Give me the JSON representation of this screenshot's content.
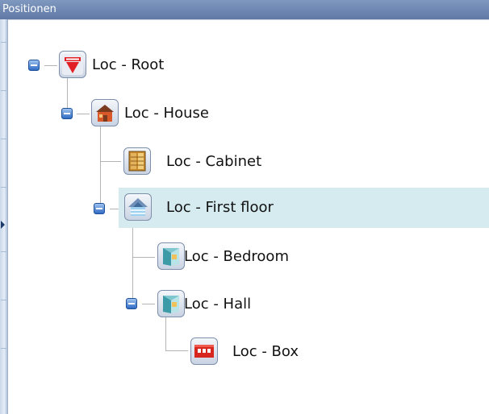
{
  "panel": {
    "title": "Positionen"
  },
  "tree": {
    "nodes": [
      {
        "label": "Loc - Root",
        "icon": "carlo-gavazzi-logo-icon",
        "expanded": true,
        "selected": false
      },
      {
        "label": "Loc - House",
        "icon": "house-icon",
        "expanded": true,
        "selected": false
      },
      {
        "label": "Loc - Cabinet",
        "icon": "cabinet-icon",
        "expanded": false,
        "selected": false
      },
      {
        "label": "Loc - First floor",
        "icon": "floor-icon",
        "expanded": true,
        "selected": true
      },
      {
        "label": "Loc - Bedroom",
        "icon": "room-icon",
        "expanded": false,
        "selected": false
      },
      {
        "label": "Loc - Hall",
        "icon": "room-icon",
        "expanded": true,
        "selected": false
      },
      {
        "label": "Loc - Box",
        "icon": "box-icon",
        "expanded": false,
        "selected": false
      }
    ]
  },
  "colors": {
    "title_bar": "#6d87b2",
    "selection": "#d6ebf0",
    "connector": "#b4b4b4"
  }
}
